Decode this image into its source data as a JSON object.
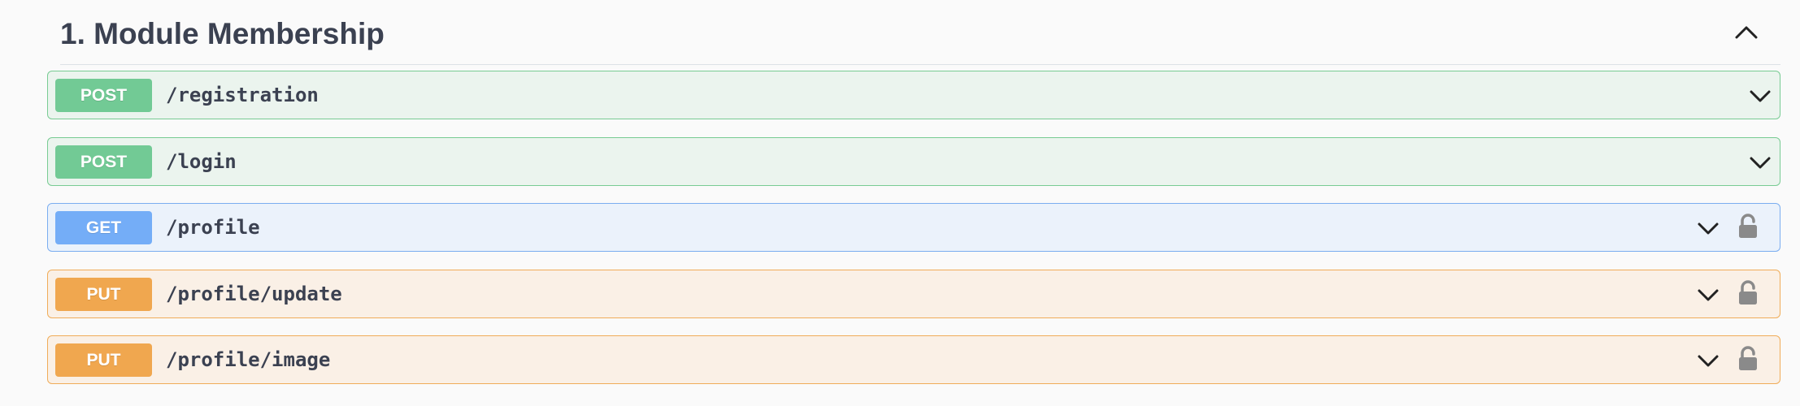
{
  "section": {
    "title": "1. Module Membership",
    "toggle_icon": "chevron-up-icon"
  },
  "operations": [
    {
      "method": "POST",
      "path": "/registration",
      "locked": false
    },
    {
      "method": "POST",
      "path": "/login",
      "locked": false
    },
    {
      "method": "GET",
      "path": "/profile",
      "locked": true
    },
    {
      "method": "PUT",
      "path": "/profile/update",
      "locked": true
    },
    {
      "method": "PUT",
      "path": "/profile/image",
      "locked": true
    }
  ],
  "colors": {
    "post": "#72ca95",
    "get": "#74adf7",
    "put": "#f0a74f",
    "text": "#3b4151",
    "lock": "#8a8a8a"
  }
}
